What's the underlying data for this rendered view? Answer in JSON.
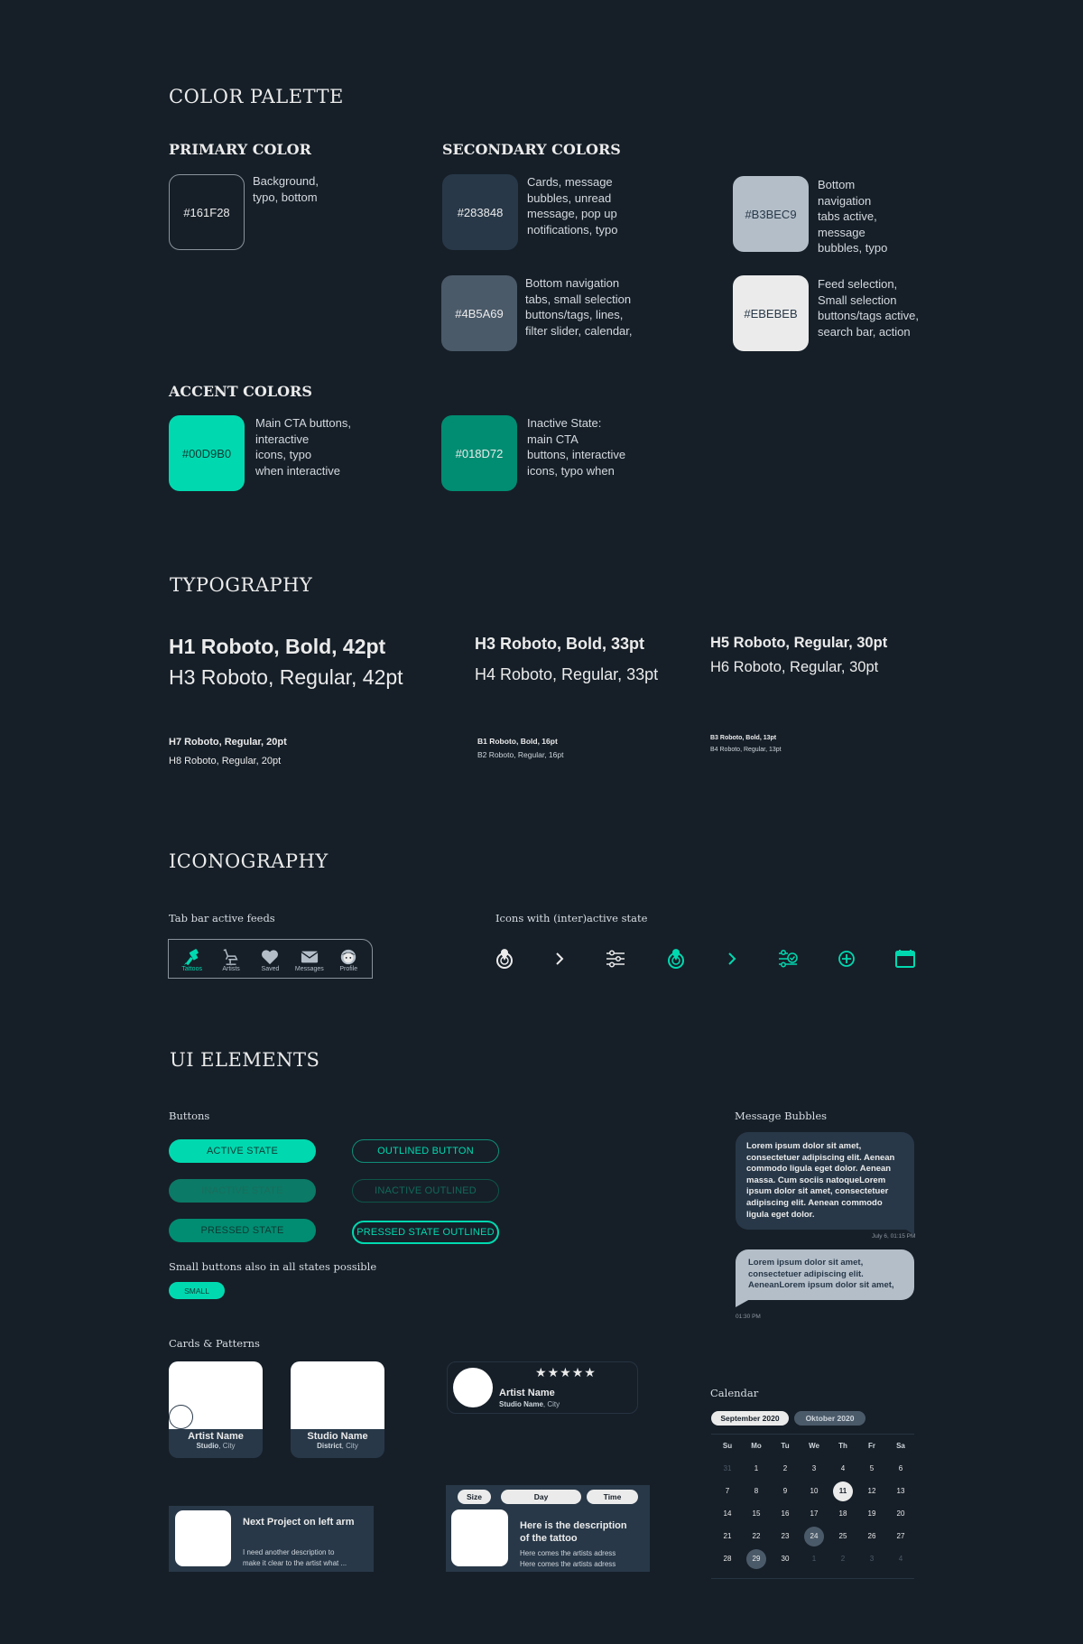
{
  "sections": {
    "color_palette": "COLOR PALETTE",
    "typography": "TYPOGRAPHY",
    "iconography": "ICONOGRAPHY",
    "ui_elements": "UI ELEMENTS"
  },
  "colors": {
    "primary_title": "PRIMARY COLOR",
    "secondary_title": "SECONDARY COLORS",
    "accent_title": "ACCENT COLORS",
    "primary": {
      "hex": "#161F28",
      "desc": [
        "Background,",
        "typo, bottom"
      ]
    },
    "secondary": [
      {
        "hex": "#283848",
        "desc": [
          "Cards, message",
          "bubbles, unread",
          "message, pop up",
          "notifications, typo"
        ]
      },
      {
        "hex": "#B3BEC9",
        "desc": [
          "Bottom",
          "navigation",
          "tabs active,",
          "message",
          "bubbles, typo"
        ]
      },
      {
        "hex": "#4B5A69",
        "desc": [
          "Bottom navigation",
          "tabs, small selection",
          "buttons/tags, lines,",
          "filter slider, calendar,"
        ]
      },
      {
        "hex": "#EBEBEB",
        "desc": [
          "Feed selection,",
          "Small selection",
          "buttons/tags active,",
          "search bar, action"
        ]
      }
    ],
    "accent": [
      {
        "hex": "#00D9B0",
        "desc": [
          "Main CTA buttons,",
          "interactive",
          "icons, typo",
          "when interactive"
        ]
      },
      {
        "hex": "#018D72",
        "desc": [
          "Inactive State:",
          "main CTA",
          "buttons, interactive",
          "icons, typo when"
        ]
      }
    ]
  },
  "typography": {
    "h1": "H1 Roboto, Bold, 42pt",
    "h3_regular": "H3 Roboto, Regular, 42pt",
    "h3_bold": "H3 Roboto, Bold, 33pt",
    "h4": "H4 Roboto, Regular, 33pt",
    "h5": "H5 Roboto, Regular, 30pt",
    "h6": "H6 Roboto, Regular, 30pt",
    "h7": "H7 Roboto, Regular, 20pt",
    "h8": "H8 Roboto, Regular, 20pt",
    "b1": "B1 Roboto, Bold, 16pt",
    "b2": "B2 Roboto, Regular, 16pt",
    "b3": "B3 Roboto, Bold, 13pt",
    "b4": "B4 Roboto, Regular, 13pt"
  },
  "iconography": {
    "tabbar_label": "Tab bar active feeds",
    "tabs": [
      {
        "label": "Tattoos",
        "icon": "tattoo-machine-icon",
        "active": true
      },
      {
        "label": "Artists",
        "icon": "tattoo-chair-icon",
        "active": false
      },
      {
        "label": "Saved",
        "icon": "heart-icon",
        "active": false
      },
      {
        "label": "Messages",
        "icon": "envelope-icon",
        "active": false
      },
      {
        "label": "Profile",
        "icon": "profile-face-icon",
        "active": false
      }
    ],
    "interactive_label": "Icons with (inter)active state",
    "icons": [
      "location-pin-icon",
      "chevron-right-icon",
      "filter-sliders-icon",
      "location-pin-icon",
      "chevron-right-icon",
      "filter-check-icon",
      "plus-circle-icon",
      "calendar-icon"
    ]
  },
  "buttons": {
    "label": "Buttons",
    "active": "ACTIVE STATE",
    "inactive": "INACTIVE STATE",
    "pressed": "PRESSED STATE",
    "outlined": "OUTLINED BUTTON",
    "inactive_outlined": "INACTIVE OUTLINED",
    "pressed_outlined": "PRESSED STATE OUTLINED",
    "small_note": "Small buttons also in all states possible",
    "small": "SMALL"
  },
  "messages": {
    "label": "Message Bubbles",
    "incoming": "Lorem ipsum dolor sit amet, consectetuer adipiscing elit. Aenean commodo ligula eget dolor. Aenean massa. Cum sociis natoqueLorem ipsum dolor sit amet, consectetuer adipiscing elit. Aenean commodo ligula eget dolor.",
    "incoming_time": "July 6, 01:15 PM",
    "outgoing": "Lorem ipsum dolor sit amet, consectetuer adipiscing elit. AeneanLorem ipsum dolor sit amet,",
    "outgoing_time": "01:30 PM"
  },
  "cards": {
    "label": "Cards & Patterns",
    "artist_card": {
      "name": "Artist Name",
      "sub_bold": "Studio",
      "sub": ", City"
    },
    "studio_card": {
      "name": "Studio Name",
      "sub_bold": "District",
      "sub": ", City"
    },
    "artist_row": {
      "name": "Artist Name",
      "sub_bold": "Studio Name",
      "sub": ", City",
      "rating": 5
    },
    "project": {
      "title": "Next Project on left arm",
      "desc1": "I need another description to",
      "desc2": "make it clear to the artist what  ..."
    },
    "tattoo": {
      "chips": [
        "Size",
        "Day",
        "Time"
      ],
      "title1": "Here is the description",
      "title2": "of the tattoo",
      "addr1": "Here comes the artists adress",
      "addr2": "Here comes the artists adress"
    }
  },
  "calendar": {
    "label": "Calendar",
    "months": [
      {
        "label": "September 2020",
        "active": true
      },
      {
        "label": "Oktober 2020",
        "active": false
      }
    ],
    "weekdays": [
      "Su",
      "Mo",
      "Tu",
      "We",
      "Th",
      "Fr",
      "Sa"
    ],
    "days": [
      {
        "d": "31",
        "s": "muted"
      },
      {
        "d": "1"
      },
      {
        "d": "2"
      },
      {
        "d": "3"
      },
      {
        "d": "4"
      },
      {
        "d": "5"
      },
      {
        "d": "6"
      },
      {
        "d": "7"
      },
      {
        "d": "8"
      },
      {
        "d": "9"
      },
      {
        "d": "10"
      },
      {
        "d": "11",
        "s": "selected"
      },
      {
        "d": "12"
      },
      {
        "d": "13"
      },
      {
        "d": "14"
      },
      {
        "d": "15"
      },
      {
        "d": "16"
      },
      {
        "d": "17"
      },
      {
        "d": "18"
      },
      {
        "d": "19"
      },
      {
        "d": "20"
      },
      {
        "d": "21"
      },
      {
        "d": "22"
      },
      {
        "d": "23"
      },
      {
        "d": "24",
        "s": "marked"
      },
      {
        "d": "25"
      },
      {
        "d": "26"
      },
      {
        "d": "27"
      },
      {
        "d": "28"
      },
      {
        "d": "29",
        "s": "marked"
      },
      {
        "d": "30"
      },
      {
        "d": "1",
        "s": "muted"
      },
      {
        "d": "2",
        "s": "muted"
      },
      {
        "d": "3",
        "s": "muted"
      },
      {
        "d": "4",
        "s": "muted"
      }
    ]
  }
}
